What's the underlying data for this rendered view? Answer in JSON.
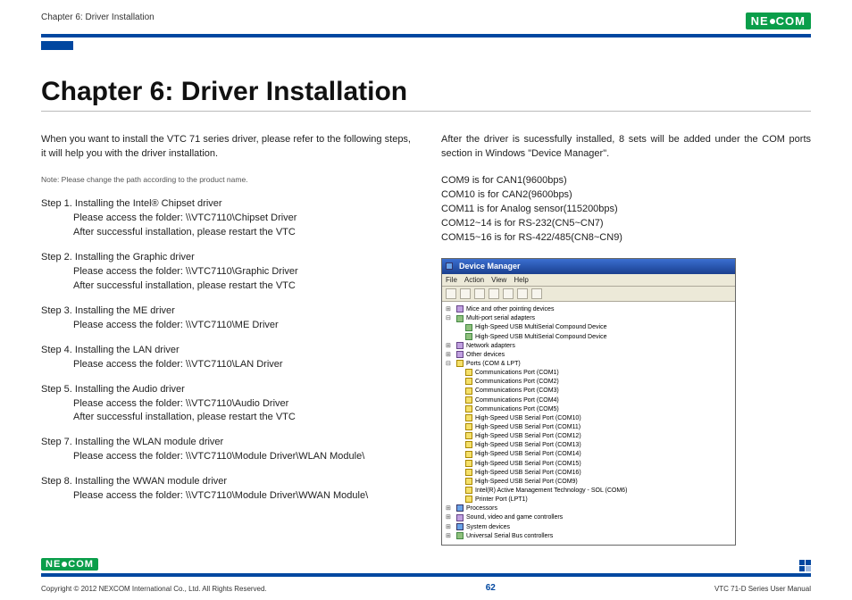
{
  "header": {
    "breadcrumb": "Chapter 6: Driver Installation",
    "logo_left": "NE",
    "logo_right": "COM"
  },
  "title": "Chapter 6: Driver Installation",
  "left": {
    "intro": "When you want to install the VTC 71 series driver, please refer to the following steps, it will help you with the driver installation.",
    "note": "Note: Please change the path according to the product name.",
    "steps": [
      {
        "hd": "Step 1. Installing the Intel® Chipset driver",
        "l1": "Please access the folder: \\\\VTC7110\\Chipset Driver",
        "l2": "After successful installation, please restart the VTC"
      },
      {
        "hd": "Step 2. Installing the Graphic driver",
        "l1": "Please access the folder: \\\\VTC7110\\Graphic Driver",
        "l2": "After successful installation, please restart the VTC"
      },
      {
        "hd": "Step 3. Installing the ME driver",
        "l1": "Please access the folder: \\\\VTC7110\\ME Driver",
        "l2": ""
      },
      {
        "hd": "Step 4. Installing the LAN driver",
        "l1": "Please access the folder: \\\\VTC7110\\LAN Driver",
        "l2": ""
      },
      {
        "hd": "Step 5. Installing the Audio driver",
        "l1": "Please access the folder: \\\\VTC7110\\Audio Driver",
        "l2": "After successful installation, please restart the VTC"
      },
      {
        "hd": "Step 7. Installing the WLAN module driver",
        "l1": "Please access the folder: \\\\VTC7110\\Module Driver\\WLAN Module\\",
        "l2": ""
      },
      {
        "hd": "Step 8. Installing the WWAN module driver",
        "l1": "Please access the folder: \\\\VTC7110\\Module Driver\\WWAN Module\\",
        "l2": ""
      }
    ]
  },
  "right": {
    "intro": "After the driver is sucessfully installed, 8 sets will be added under the COM ports section in Windows \"Device Manager\".",
    "com_lines": [
      "COM9 is for CAN1(9600bps)",
      "COM10 is for CAN2(9600bps)",
      "COM11 is for Analog sensor(115200bps)",
      "COM12~14 is for RS-232(CN5~CN7)",
      "COM15~16 is for RS-422/485(CN8~CN9)"
    ],
    "devmgr": {
      "title": "Device Manager",
      "menu": [
        "File",
        "Action",
        "View",
        "Help"
      ],
      "tree": {
        "mice": "Mice and other pointing devices",
        "multiport": "Multi-port serial adapters",
        "multiport_children": [
          "High-Speed USB MultiSerial Compound Device",
          "High-Speed USB MultiSerial Compound Device"
        ],
        "network": "Network adapters",
        "other": "Other devices",
        "ports": "Ports (COM & LPT)",
        "ports_children": [
          "Communications Port (COM1)",
          "Communications Port (COM2)",
          "Communications Port (COM3)",
          "Communications Port (COM4)",
          "Communications Port (COM5)",
          "High-Speed USB Serial Port (COM10)",
          "High-Speed USB Serial Port (COM11)",
          "High-Speed USB Serial Port (COM12)",
          "High-Speed USB Serial Port (COM13)",
          "High-Speed USB Serial Port (COM14)",
          "High-Speed USB Serial Port (COM15)",
          "High-Speed USB Serial Port (COM16)",
          "High-Speed USB Serial Port (COM9)",
          "Intel(R) Active Management Technology - SOL (COM6)",
          "Printer Port (LPT1)"
        ],
        "processors": "Processors",
        "sound": "Sound, video and game controllers",
        "system": "System devices",
        "usb": "Universal Serial Bus controllers"
      }
    }
  },
  "footer": {
    "copyright": "Copyright © 2012 NEXCOM International Co., Ltd. All Rights Reserved.",
    "page": "62",
    "manual": "VTC 71-D Series User Manual"
  }
}
